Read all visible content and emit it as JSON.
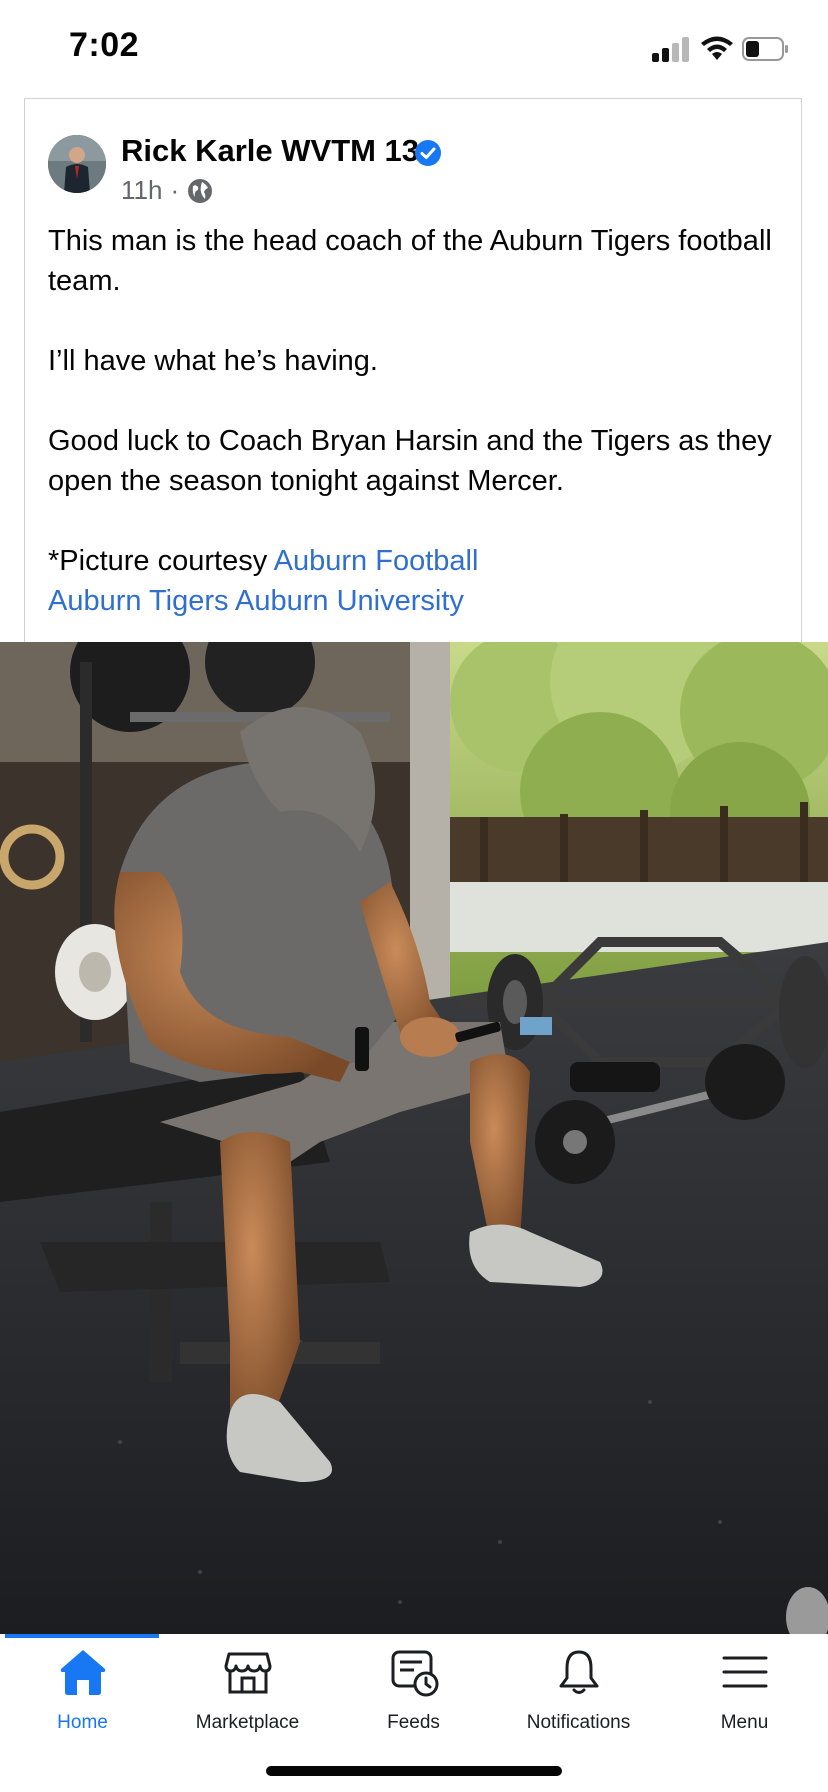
{
  "status_bar": {
    "time": "7:02",
    "icons": [
      "cellular-signal-icon",
      "wifi-icon",
      "battery-icon"
    ]
  },
  "post": {
    "author": "Rick Karle WVTM 13",
    "verified_icon": "verified-badge-icon",
    "timestamp": "11h",
    "separator": "·",
    "audience_icon": "globe-icon",
    "paragraphs": [
      "This man is the head coach of the Auburn Tigers football team.",
      "I’ll have what he’s having.",
      "Good luck to Coach Bryan Harsin and the Tigers as they open the season tonight against Mercer."
    ],
    "credit_prefix": "*Picture courtesy",
    "links": [
      "Auburn Football",
      "Auburn Tigers",
      "Auburn University"
    ],
    "link_color": "#2f6fcf"
  },
  "photo": {
    "description_icon": "post-photo"
  },
  "bottom_nav": {
    "accent": "#1877f2",
    "items": [
      {
        "label": "Home",
        "icon": "home-icon",
        "active": true
      },
      {
        "label": "Marketplace",
        "icon": "marketplace-icon",
        "active": false
      },
      {
        "label": "Feeds",
        "icon": "feeds-icon",
        "active": false
      },
      {
        "label": "Notifications",
        "icon": "bell-icon",
        "active": false
      },
      {
        "label": "Menu",
        "icon": "menu-icon",
        "active": false
      }
    ]
  }
}
